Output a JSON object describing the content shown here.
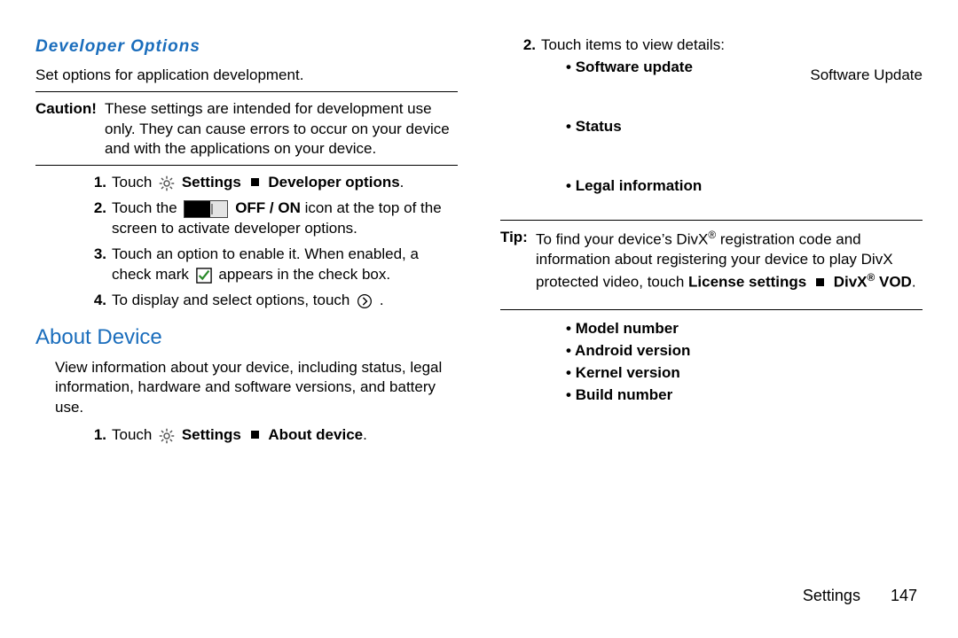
{
  "left": {
    "devHeading": "Developer Options",
    "devIntro": "Set options for application development.",
    "caution_label": "Caution!",
    "caution_body": "These settings are intended for development use only. They can cause errors to occur on your device and with the applications on your device.",
    "steps": {
      "s1": {
        "num": "1.",
        "t_touch": "Touch ",
        "t_settings": "Settings",
        "t_devopt": "Developer options",
        "t_end": "."
      },
      "s2": {
        "num": "2.",
        "t_touchthe": "Touch the ",
        "t_offon": "OFF / ON",
        "t_rest": " icon at the top of the screen to activate developer options."
      },
      "s3": {
        "num": "3.",
        "t_a": "Touch an option to enable it. When enabled, a check mark ",
        "t_b": " appears in the check box."
      },
      "s4": {
        "num": "4.",
        "t_a": "To display and select options, touch ",
        "t_end": " ."
      }
    },
    "aboutHeading": "About Device",
    "aboutIntro": "View information about your device, including status, legal information, hardware and software versions, and battery use.",
    "aboutStep1": {
      "num": "1.",
      "t_touch": "Touch ",
      "t_settings": "Settings",
      "t_about": "About device",
      "t_end": "."
    }
  },
  "right": {
    "step2": {
      "num": "2.",
      "text": "Touch items to view details:"
    },
    "bullets1": {
      "b1": "Software update",
      "b1_right": "Software Update",
      "b2": "Status",
      "b3": "Legal information"
    },
    "tip": {
      "label": "Tip:",
      "a": "To find your device’s DivX",
      "b": " registration code and information about registering your device to play DivX protected video, touch ",
      "lic": "License settings",
      "divx": "DivX",
      "vod": " VOD",
      "end": "."
    },
    "bullets2": {
      "b1": "Model number",
      "b2": "Android version",
      "b3": "Kernel version",
      "b4": "Build number"
    }
  },
  "footer": {
    "section": "Settings",
    "page": "147"
  }
}
